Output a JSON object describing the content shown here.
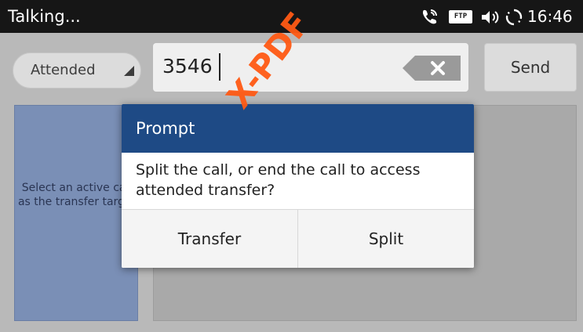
{
  "status_bar": {
    "title": "Talking...",
    "ftp_badge": "FTP",
    "time": "16:46",
    "icons": [
      "phone-call-icon",
      "ftp-icon",
      "volume-icon",
      "sync-icon"
    ]
  },
  "toolbar": {
    "transfer_mode": "Attended",
    "dial_value": "3546",
    "send_label": "Send"
  },
  "target_panel": {
    "text": "Select an active call as the transfer target"
  },
  "dialog": {
    "title": "Prompt",
    "message": "Split the call, or end the call to access attended transfer?",
    "buttons": {
      "transfer": "Transfer",
      "split": "Split"
    }
  },
  "watermark": {
    "text": "X-PDF"
  },
  "colors": {
    "status_bar": "#161616",
    "dialog_header": "#1e4a85",
    "target_panel": "#7a8fb6",
    "watermark": "#ff5a14"
  }
}
